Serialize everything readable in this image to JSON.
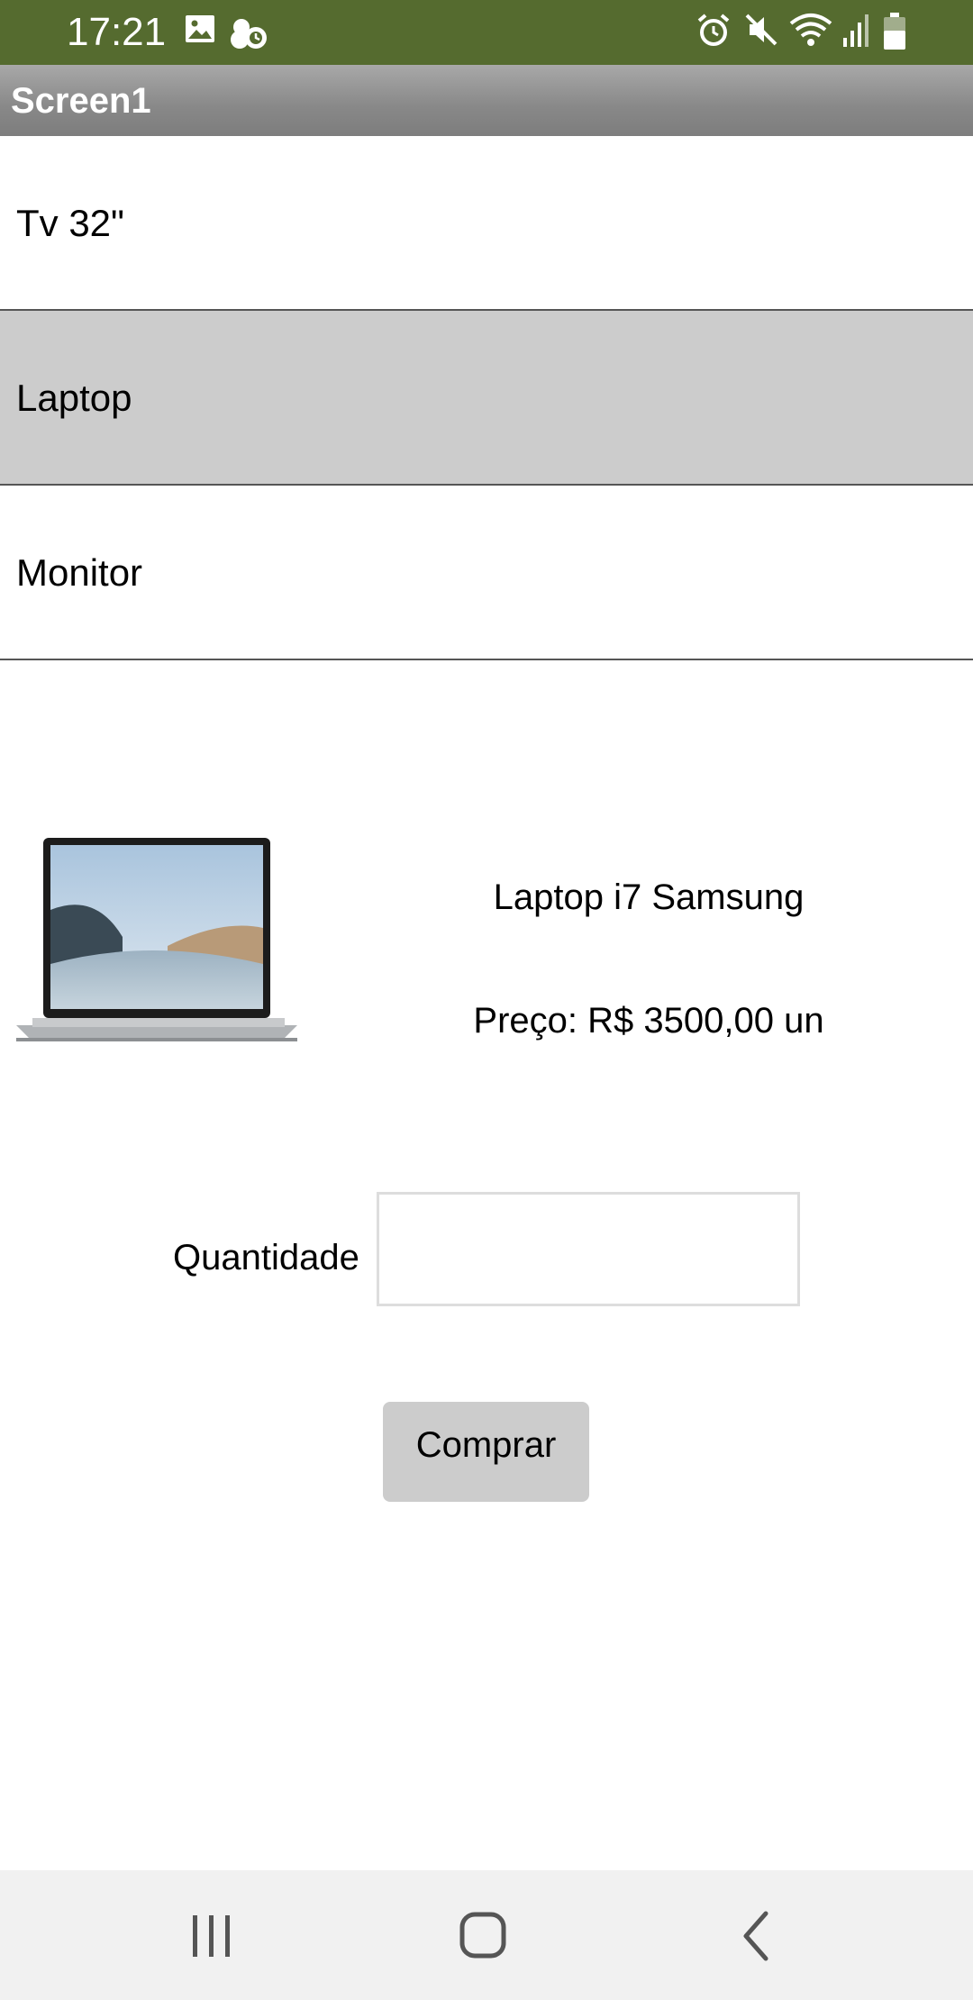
{
  "status_bar": {
    "time": "17:21",
    "left_icons": [
      "image-icon",
      "weather-icon"
    ],
    "right_icons": [
      "alarm-icon",
      "mute-icon",
      "wifi-icon",
      "signal-icon",
      "battery-icon"
    ]
  },
  "app": {
    "title": "Screen1"
  },
  "list": {
    "items": [
      {
        "label": "Tv 32\""
      },
      {
        "label": "Laptop"
      },
      {
        "label": "Monitor"
      }
    ],
    "selected_index": 1
  },
  "product": {
    "image_icon": "laptop-image",
    "name": "Laptop i7 Samsung",
    "price": "Preço: R$ 3500,00 un"
  },
  "form": {
    "quantity_label": "Quantidade",
    "quantity_value": "",
    "buy_label": "Comprar"
  },
  "nav_bar": {
    "buttons": [
      "recent-apps-icon",
      "home-icon",
      "back-icon"
    ]
  },
  "colors": {
    "status_bar": "#556b2f",
    "title_bar": "#888888",
    "selected_item": "#cccccc",
    "button": "#cccccc",
    "nav_bar": "#f1f1f1"
  }
}
